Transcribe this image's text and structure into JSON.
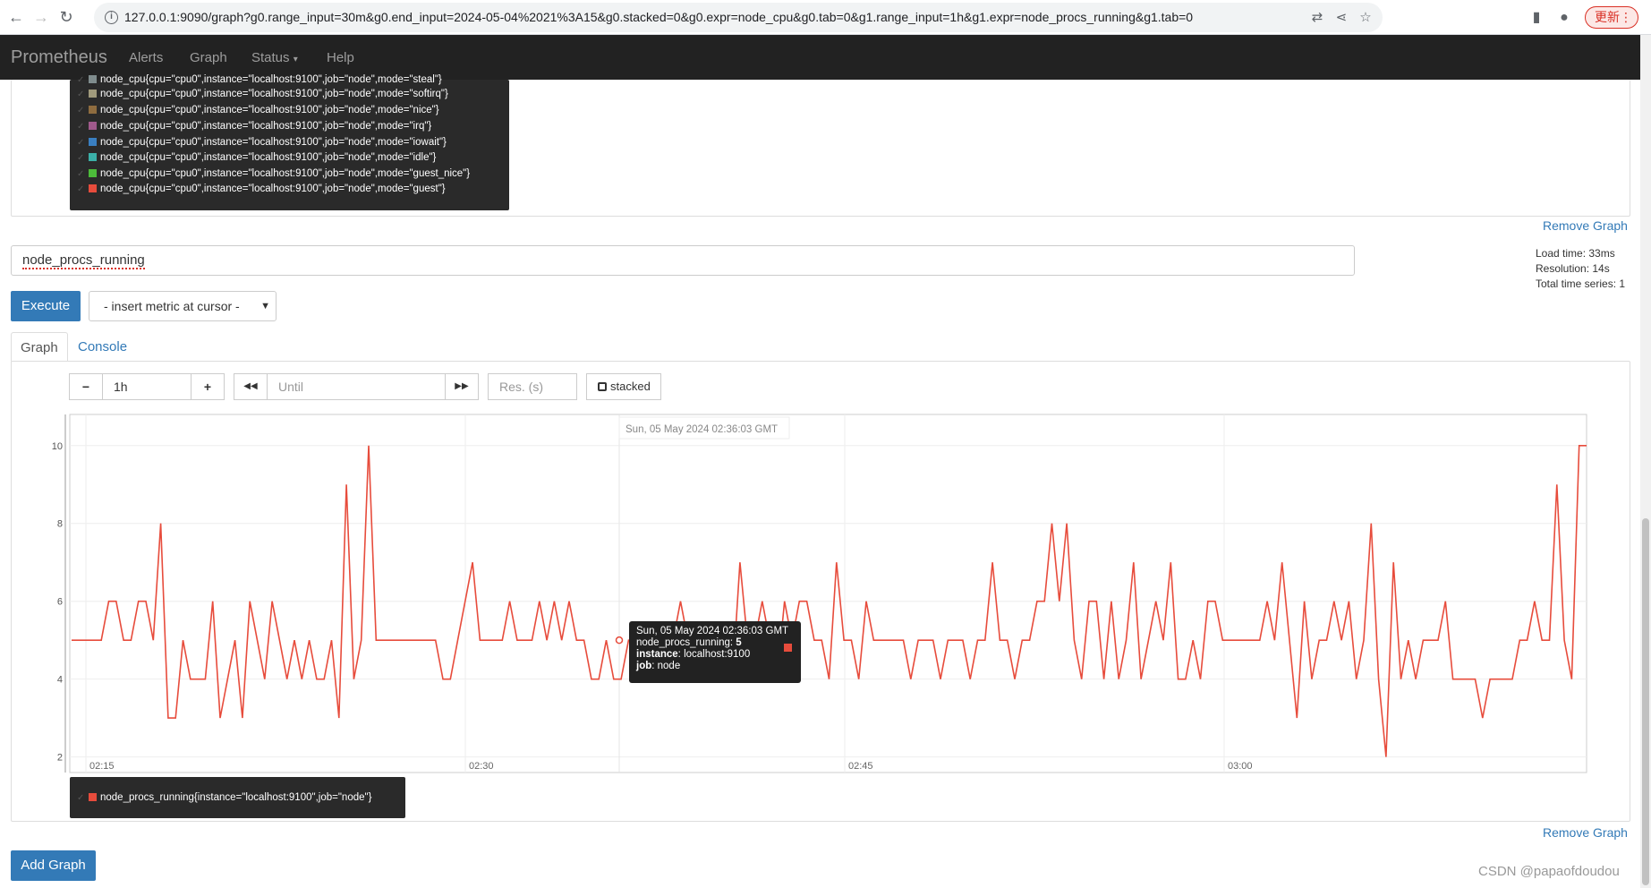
{
  "browser": {
    "url": "127.0.0.1:9090/graph?g0.range_input=30m&g0.end_input=2024-05-04%2021%3A15&g0.stacked=0&g0.expr=node_cpu&g0.tab=0&g1.range_input=1h&g1.expr=node_procs_running&g1.tab=0",
    "update_label": "更新"
  },
  "navbar": {
    "brand": "Prometheus",
    "items": [
      "Alerts",
      "Graph",
      "Status",
      "Help"
    ]
  },
  "graph0": {
    "legend": [
      {
        "label": "node_cpu{cpu=\"cpu0\",instance=\"localhost:9100\",job=\"node\",mode=\"steal\"}",
        "color": "#7f8c8d"
      },
      {
        "label": "node_cpu{cpu=\"cpu0\",instance=\"localhost:9100\",job=\"node\",mode=\"softirq\"}",
        "color": "#a09a7c"
      },
      {
        "label": "node_cpu{cpu=\"cpu0\",instance=\"localhost:9100\",job=\"node\",mode=\"nice\"}",
        "color": "#8e6c3f"
      },
      {
        "label": "node_cpu{cpu=\"cpu0\",instance=\"localhost:9100\",job=\"node\",mode=\"irq\"}",
        "color": "#a05a8c"
      },
      {
        "label": "node_cpu{cpu=\"cpu0\",instance=\"localhost:9100\",job=\"node\",mode=\"iowait\"}",
        "color": "#3a7fc1"
      },
      {
        "label": "node_cpu{cpu=\"cpu0\",instance=\"localhost:9100\",job=\"node\",mode=\"idle\"}",
        "color": "#3bb0a8"
      },
      {
        "label": "node_cpu{cpu=\"cpu0\",instance=\"localhost:9100\",job=\"node\",mode=\"guest_nice\"}",
        "color": "#4cbb3a"
      },
      {
        "label": "node_cpu{cpu=\"cpu0\",instance=\"localhost:9100\",job=\"node\",mode=\"guest\"}",
        "color": "#e74c3c"
      }
    ],
    "remove_label": "Remove Graph"
  },
  "graph1": {
    "expression": "node_procs_running",
    "stats": {
      "load_time": "Load time: 33ms",
      "resolution": "Resolution: 14s",
      "total_series": "Total time series: 1"
    },
    "execute_label": "Execute",
    "insert_metric_label": "- insert metric at cursor -",
    "tabs": [
      "Graph",
      "Console"
    ],
    "controls": {
      "minus": "−",
      "range": "1h",
      "plus": "+",
      "back": "◀◀",
      "until_placeholder": "Until",
      "forward": "▶▶",
      "res_placeholder": "Res. (s)",
      "stacked_label": "stacked"
    },
    "hover_time": "Sun, 05 May 2024 02:36:03 GMT",
    "tooltip": {
      "time": "Sun, 05 May 2024 02:36:03 GMT",
      "metric_key": "node_procs_running",
      "metric_value": "5",
      "instance_key": "instance",
      "instance_value": "localhost:9100",
      "job_key": "job",
      "job_value": "node"
    },
    "legend_label": "node_procs_running{instance=\"localhost:9100\",job=\"node\"}",
    "remove_label": "Remove Graph"
  },
  "add_graph_label": "Add Graph",
  "watermark": "CSDN @papaofdoudou",
  "chart_data": {
    "type": "line",
    "x_axis_ticks": [
      "02:15",
      "02:30",
      "02:45",
      "03:00"
    ],
    "y_axis_ticks": [
      2,
      4,
      6,
      8,
      10
    ],
    "ylim": [
      1.6,
      10.8
    ],
    "series": [
      {
        "name": "node_procs_running{instance=\"localhost:9100\",job=\"node\"}",
        "color": "#e74c3c",
        "values": [
          5,
          5,
          5,
          5,
          5,
          6,
          6,
          5,
          5,
          6,
          6,
          5,
          8,
          3,
          3,
          5,
          4,
          4,
          4,
          6,
          3,
          4,
          5,
          3,
          6,
          5,
          4,
          6,
          5,
          4,
          5,
          4,
          5,
          4,
          4,
          5,
          3,
          9,
          4,
          5,
          10,
          5,
          5,
          5,
          5,
          5,
          5,
          5,
          5,
          5,
          4,
          4,
          5,
          6,
          7,
          5,
          5,
          5,
          5,
          6,
          5,
          5,
          5,
          6,
          5,
          6,
          5,
          6,
          5,
          5,
          4,
          4,
          5,
          4,
          4,
          5,
          5,
          5,
          5,
          5,
          5,
          5,
          6,
          5,
          5,
          5,
          4,
          4,
          5,
          4,
          7,
          5,
          5,
          6,
          5,
          4,
          6,
          5,
          6,
          6,
          5,
          5,
          4,
          7,
          5,
          5,
          4,
          6,
          5,
          5,
          5,
          5,
          5,
          4,
          5,
          5,
          5,
          4,
          5,
          5,
          5,
          4,
          5,
          5,
          7,
          5,
          5,
          4,
          5,
          5,
          6,
          6,
          8,
          6,
          8,
          5,
          4,
          6,
          6,
          4,
          6,
          4,
          5,
          7,
          4,
          5,
          6,
          5,
          7,
          4,
          4,
          5,
          4,
          6,
          6,
          5,
          5,
          5,
          5,
          5,
          5,
          6,
          5,
          7,
          5,
          3,
          6,
          4,
          5,
          5,
          6,
          5,
          6,
          4,
          5,
          8,
          4,
          2,
          7,
          4,
          5,
          4,
          5,
          5,
          5,
          6,
          4,
          4,
          4,
          4,
          3,
          4,
          4,
          4,
          4,
          5,
          5,
          6,
          5,
          5,
          9,
          5,
          4,
          10,
          10
        ]
      }
    ]
  }
}
